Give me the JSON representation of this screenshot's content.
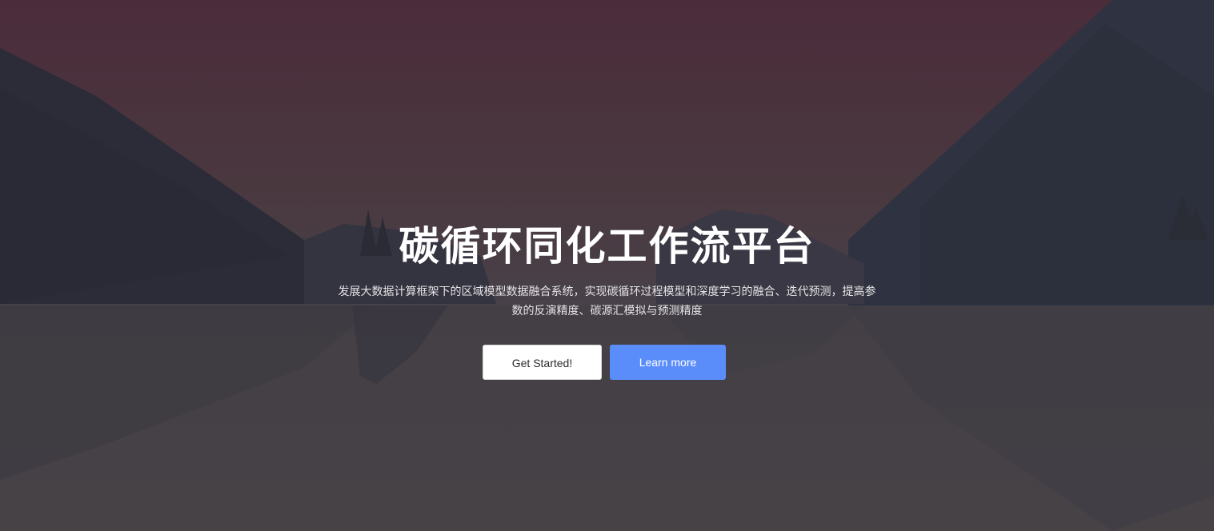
{
  "hero": {
    "title": "碳循环同化工作流平台",
    "subtitle": "发展大数据计算框架下的区域模型数据融合系统，实现碳循环过程模型和深度学习的融合、迭代预测，提高参数的反演精度、碳源汇模拟与预测精度"
  },
  "buttons": {
    "get_started": "Get Started!",
    "learn_more": "Learn more"
  },
  "colors": {
    "accent": "#5b8dfa",
    "background": "#3b3a40"
  }
}
